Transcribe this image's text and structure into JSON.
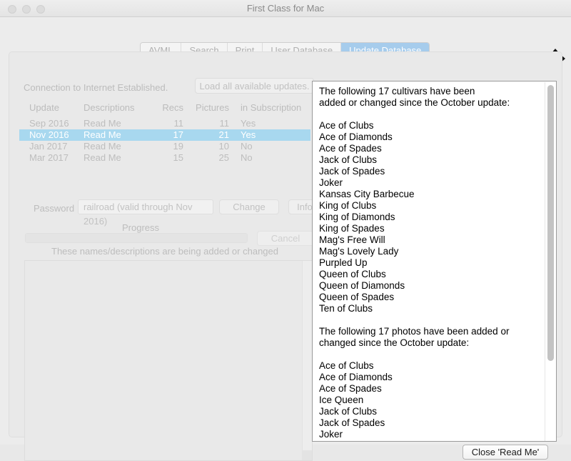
{
  "window": {
    "title": "First Class for Mac",
    "controls": {
      "close": "close-button",
      "minimize": "minimize-button",
      "maximize": "maximize-button"
    },
    "move_cursor_icon": "move-resize-arrows-icon"
  },
  "tabs": [
    {
      "label": "AVML",
      "selected": false
    },
    {
      "label": "Search",
      "selected": false
    },
    {
      "label": "Print",
      "selected": false
    },
    {
      "label": "User Database",
      "selected": false
    },
    {
      "label": "Update Database",
      "selected": true
    }
  ],
  "update_panel": {
    "connection_status": "Connection to Internet Established.",
    "load_updates_label": "Load all available updates.",
    "table": {
      "headers": [
        "Update",
        "Descriptions",
        "Recs",
        "Pictures",
        "in Subscription"
      ],
      "rows": [
        {
          "update": "Sep 2016",
          "descriptions": "Read Me",
          "recs": "11",
          "pictures": "11",
          "subscription": "Yes",
          "selected": false
        },
        {
          "update": "Nov 2016",
          "descriptions": "Read Me",
          "recs": "17",
          "pictures": "21",
          "subscription": "Yes",
          "selected": true
        },
        {
          "update": "Jan 2017",
          "descriptions": "Read Me",
          "recs": "19",
          "pictures": "10",
          "subscription": "No",
          "selected": false
        },
        {
          "update": "Mar 2017",
          "descriptions": "Read Me",
          "recs": "15",
          "pictures": "25",
          "subscription": "No",
          "selected": false
        }
      ]
    },
    "password": {
      "label": "Password",
      "value": "railroad (valid through Nov 2016)",
      "change_label": "Change",
      "info_label": "Info"
    },
    "progress": {
      "label": "Progress",
      "percent": 0,
      "cancel_label": "Cancel"
    },
    "added_changed_label": "These names/descriptions are being added or changed",
    "name_list": []
  },
  "readme": {
    "cultivars_heading": "The following 17 cultivars have been\nadded or changed since the October update:",
    "cultivars": [
      "Ace of Clubs",
      "Ace of Diamonds",
      "Ace of Spades",
      "Jack of Clubs",
      "Jack of Spades",
      "Joker",
      "Kansas City Barbecue",
      "King of Clubs",
      "King of Diamonds",
      "King of Spades",
      "Mag's Free Will",
      "Mag's Lovely Lady",
      "Purpled Up",
      "Queen of Clubs",
      "Queen of Diamonds",
      "Queen of Spades",
      "Ten of Clubs"
    ],
    "photos_heading": "The following 17 photos have been added or\nchanged since the October update:",
    "photos": [
      "Ace of Clubs",
      "Ace of Diamonds",
      "Ace of Spades",
      "Ice Queen",
      "Jack of Clubs",
      "Jack of Spades",
      "Joker"
    ],
    "scroll_thumb_percent": 77,
    "close_label": "Close 'Read Me'"
  },
  "colors": {
    "selection_blue": "#a8d8ef",
    "tab_selected_blue": "#a6ccec",
    "window_bg": "#ececec",
    "panel_bg": "#e9e9e9",
    "disabled_text": "#bdbdbd"
  }
}
